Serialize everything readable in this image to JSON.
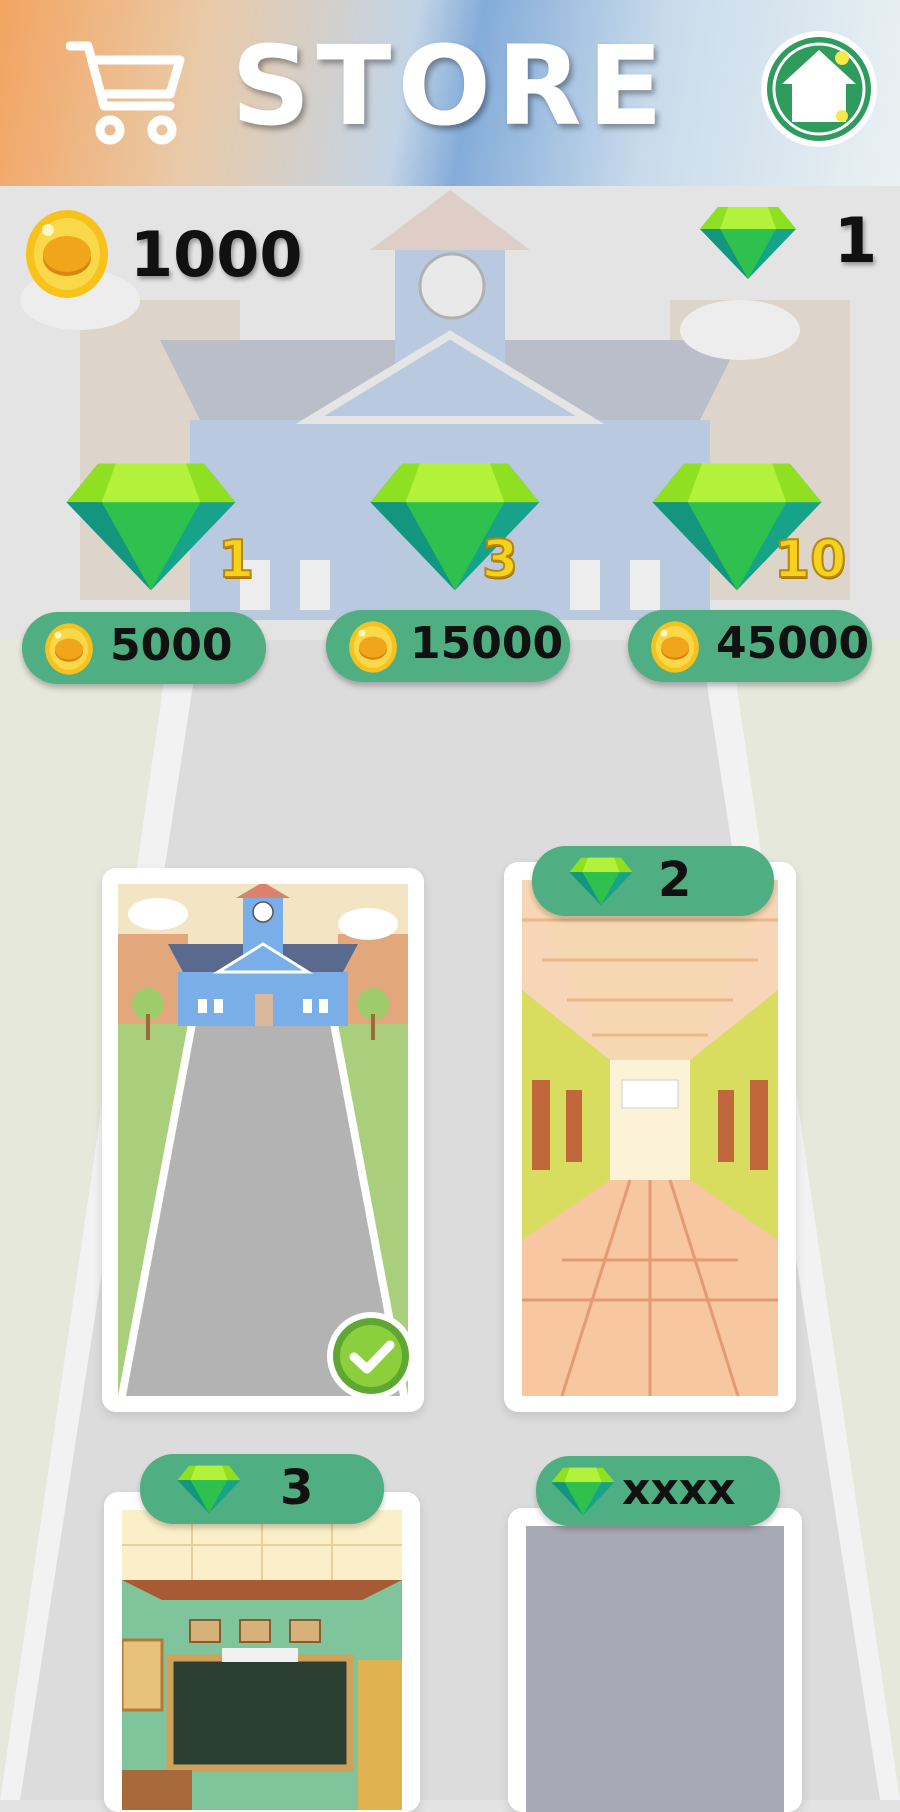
{
  "header": {
    "title": "STORE",
    "cart_icon": "cart-icon",
    "home_icon": "home-icon"
  },
  "wallet": {
    "coins": "1000",
    "gems": "1"
  },
  "gem_packs": [
    {
      "gems": "1",
      "price": "5000"
    },
    {
      "gems": "3",
      "price": "15000"
    },
    {
      "gems": "10",
      "price": "45000"
    }
  ],
  "backgrounds": [
    {
      "scene": "school-exterior",
      "selected": true
    },
    {
      "scene": "hallway",
      "cost": "2"
    },
    {
      "scene": "classroom",
      "cost": "3"
    },
    {
      "scene": "locked",
      "cost": "xxxx"
    }
  ],
  "colors": {
    "pill_green": "#4fae82",
    "gem_light": "#8ee021",
    "gem_dark": "#16a38a",
    "coin_gold": "#f2b51b"
  }
}
